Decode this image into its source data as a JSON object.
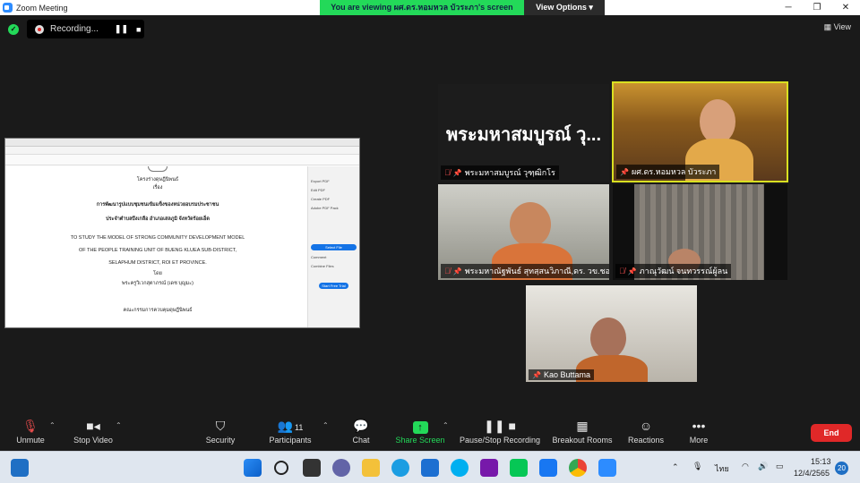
{
  "window": {
    "title": "Zoom Meeting"
  },
  "banner": {
    "viewing_text": "You are viewing ผศ.ดร.หอมหวล บัวระภา's screen",
    "view_options": "View Options ▾"
  },
  "recording": {
    "label": "Recording..."
  },
  "view_button": {
    "label": "View"
  },
  "shared_doc": {
    "lines": [
      "โครงร่างดุษฎีนิพนธ์",
      "เรื่อง",
      "การพัฒนารูปแบบชุมชนเข้มแข็งของหน่วยอบรมประชาชน",
      "ประจำตำบลบึงเกลือ อำเภอเสลภูมิ จังหวัดร้อยเอ็ด",
      "TO STUDY THE MODEL OF STRONG COMMUNITY DEVELOPMENT MODEL",
      "OF THE PEOPLE TRAINING UNIT OF BUENG KLUEA SUB-DISTRICT,",
      "SELAPHUM DISTRICT, ROI  ET PROVINCE.",
      "โดย",
      "พระครูวิเวกสุตาภรณ์ (เดช บุญมะ)",
      "คณะกรรมการควบคุมดุษฎีนิพนธ์"
    ],
    "panel_items": [
      "Export PDF",
      "Edit PDF",
      "Create PDF",
      "Adobe PDF Pack",
      "Select File",
      "Comment",
      "Combine Files",
      "Start Free Trial"
    ]
  },
  "participants": [
    {
      "name": "พระมหาสมบูรณ์ วุฑฺฒิกโร",
      "big_name": "พระมหาสมบูรณ์ วุ...",
      "muted": true
    },
    {
      "name": "ผศ.ดร.หอมหวล บัวระภา",
      "muted": false
    },
    {
      "name": "พระมหาณัฐพันธ์ สุทสฺสนวิภาณี,ดร. วข.ชอ...",
      "muted": true
    },
    {
      "name": "ภาณุวัฒน์ จนทวรรณ์ผู้ลน",
      "muted": true
    },
    {
      "name": "Kao Buttama",
      "muted": false
    }
  ],
  "toolbar": {
    "unmute": "Unmute",
    "stop_video": "Stop Video",
    "security": "Security",
    "participants": "Participants",
    "participants_count": "11",
    "chat": "Chat",
    "share_screen": "Share Screen",
    "pause_stop": "Pause/Stop Recording",
    "breakout": "Breakout Rooms",
    "reactions": "Reactions",
    "more": "More",
    "end": "End"
  },
  "tray": {
    "language": "ไทย",
    "time": "15:13",
    "date": "12/4/2565",
    "badge": "20"
  },
  "colors": {
    "accent_green": "#23d959",
    "end_red": "#e02828",
    "active_border": "#d9e021"
  }
}
